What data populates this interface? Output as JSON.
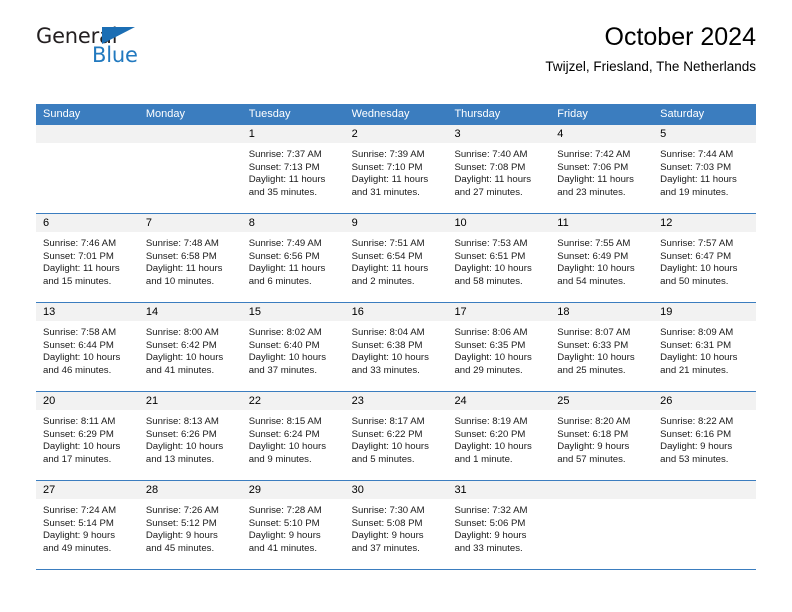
{
  "logo": {
    "text_top": "General",
    "text_bottom": "Blue",
    "triangle_color": "#1b6eb4",
    "blue_color": "#2179bf"
  },
  "header": {
    "title": "October 2024",
    "subtitle": "Twijzel, Friesland, The Netherlands"
  },
  "theme": {
    "header_blue": "#3b7dbf",
    "day_band_gray": "#f2f2f2"
  },
  "day_headers": [
    "Sunday",
    "Monday",
    "Tuesday",
    "Wednesday",
    "Thursday",
    "Friday",
    "Saturday"
  ],
  "weeks": [
    [
      {
        "day": "",
        "lines": []
      },
      {
        "day": "",
        "lines": []
      },
      {
        "day": "1",
        "lines": [
          "Sunrise: 7:37 AM",
          "Sunset: 7:13 PM",
          "Daylight: 11 hours",
          "and 35 minutes."
        ]
      },
      {
        "day": "2",
        "lines": [
          "Sunrise: 7:39 AM",
          "Sunset: 7:10 PM",
          "Daylight: 11 hours",
          "and 31 minutes."
        ]
      },
      {
        "day": "3",
        "lines": [
          "Sunrise: 7:40 AM",
          "Sunset: 7:08 PM",
          "Daylight: 11 hours",
          "and 27 minutes."
        ]
      },
      {
        "day": "4",
        "lines": [
          "Sunrise: 7:42 AM",
          "Sunset: 7:06 PM",
          "Daylight: 11 hours",
          "and 23 minutes."
        ]
      },
      {
        "day": "5",
        "lines": [
          "Sunrise: 7:44 AM",
          "Sunset: 7:03 PM",
          "Daylight: 11 hours",
          "and 19 minutes."
        ]
      }
    ],
    [
      {
        "day": "6",
        "lines": [
          "Sunrise: 7:46 AM",
          "Sunset: 7:01 PM",
          "Daylight: 11 hours",
          "and 15 minutes."
        ]
      },
      {
        "day": "7",
        "lines": [
          "Sunrise: 7:48 AM",
          "Sunset: 6:58 PM",
          "Daylight: 11 hours",
          "and 10 minutes."
        ]
      },
      {
        "day": "8",
        "lines": [
          "Sunrise: 7:49 AM",
          "Sunset: 6:56 PM",
          "Daylight: 11 hours",
          "and 6 minutes."
        ]
      },
      {
        "day": "9",
        "lines": [
          "Sunrise: 7:51 AM",
          "Sunset: 6:54 PM",
          "Daylight: 11 hours",
          "and 2 minutes."
        ]
      },
      {
        "day": "10",
        "lines": [
          "Sunrise: 7:53 AM",
          "Sunset: 6:51 PM",
          "Daylight: 10 hours",
          "and 58 minutes."
        ]
      },
      {
        "day": "11",
        "lines": [
          "Sunrise: 7:55 AM",
          "Sunset: 6:49 PM",
          "Daylight: 10 hours",
          "and 54 minutes."
        ]
      },
      {
        "day": "12",
        "lines": [
          "Sunrise: 7:57 AM",
          "Sunset: 6:47 PM",
          "Daylight: 10 hours",
          "and 50 minutes."
        ]
      }
    ],
    [
      {
        "day": "13",
        "lines": [
          "Sunrise: 7:58 AM",
          "Sunset: 6:44 PM",
          "Daylight: 10 hours",
          "and 46 minutes."
        ]
      },
      {
        "day": "14",
        "lines": [
          "Sunrise: 8:00 AM",
          "Sunset: 6:42 PM",
          "Daylight: 10 hours",
          "and 41 minutes."
        ]
      },
      {
        "day": "15",
        "lines": [
          "Sunrise: 8:02 AM",
          "Sunset: 6:40 PM",
          "Daylight: 10 hours",
          "and 37 minutes."
        ]
      },
      {
        "day": "16",
        "lines": [
          "Sunrise: 8:04 AM",
          "Sunset: 6:38 PM",
          "Daylight: 10 hours",
          "and 33 minutes."
        ]
      },
      {
        "day": "17",
        "lines": [
          "Sunrise: 8:06 AM",
          "Sunset: 6:35 PM",
          "Daylight: 10 hours",
          "and 29 minutes."
        ]
      },
      {
        "day": "18",
        "lines": [
          "Sunrise: 8:07 AM",
          "Sunset: 6:33 PM",
          "Daylight: 10 hours",
          "and 25 minutes."
        ]
      },
      {
        "day": "19",
        "lines": [
          "Sunrise: 8:09 AM",
          "Sunset: 6:31 PM",
          "Daylight: 10 hours",
          "and 21 minutes."
        ]
      }
    ],
    [
      {
        "day": "20",
        "lines": [
          "Sunrise: 8:11 AM",
          "Sunset: 6:29 PM",
          "Daylight: 10 hours",
          "and 17 minutes."
        ]
      },
      {
        "day": "21",
        "lines": [
          "Sunrise: 8:13 AM",
          "Sunset: 6:26 PM",
          "Daylight: 10 hours",
          "and 13 minutes."
        ]
      },
      {
        "day": "22",
        "lines": [
          "Sunrise: 8:15 AM",
          "Sunset: 6:24 PM",
          "Daylight: 10 hours",
          "and 9 minutes."
        ]
      },
      {
        "day": "23",
        "lines": [
          "Sunrise: 8:17 AM",
          "Sunset: 6:22 PM",
          "Daylight: 10 hours",
          "and 5 minutes."
        ]
      },
      {
        "day": "24",
        "lines": [
          "Sunrise: 8:19 AM",
          "Sunset: 6:20 PM",
          "Daylight: 10 hours",
          "and 1 minute."
        ]
      },
      {
        "day": "25",
        "lines": [
          "Sunrise: 8:20 AM",
          "Sunset: 6:18 PM",
          "Daylight: 9 hours",
          "and 57 minutes."
        ]
      },
      {
        "day": "26",
        "lines": [
          "Sunrise: 8:22 AM",
          "Sunset: 6:16 PM",
          "Daylight: 9 hours",
          "and 53 minutes."
        ]
      }
    ],
    [
      {
        "day": "27",
        "lines": [
          "Sunrise: 7:24 AM",
          "Sunset: 5:14 PM",
          "Daylight: 9 hours",
          "and 49 minutes."
        ]
      },
      {
        "day": "28",
        "lines": [
          "Sunrise: 7:26 AM",
          "Sunset: 5:12 PM",
          "Daylight: 9 hours",
          "and 45 minutes."
        ]
      },
      {
        "day": "29",
        "lines": [
          "Sunrise: 7:28 AM",
          "Sunset: 5:10 PM",
          "Daylight: 9 hours",
          "and 41 minutes."
        ]
      },
      {
        "day": "30",
        "lines": [
          "Sunrise: 7:30 AM",
          "Sunset: 5:08 PM",
          "Daylight: 9 hours",
          "and 37 minutes."
        ]
      },
      {
        "day": "31",
        "lines": [
          "Sunrise: 7:32 AM",
          "Sunset: 5:06 PM",
          "Daylight: 9 hours",
          "and 33 minutes."
        ]
      },
      {
        "day": "",
        "lines": []
      },
      {
        "day": "",
        "lines": []
      }
    ]
  ]
}
